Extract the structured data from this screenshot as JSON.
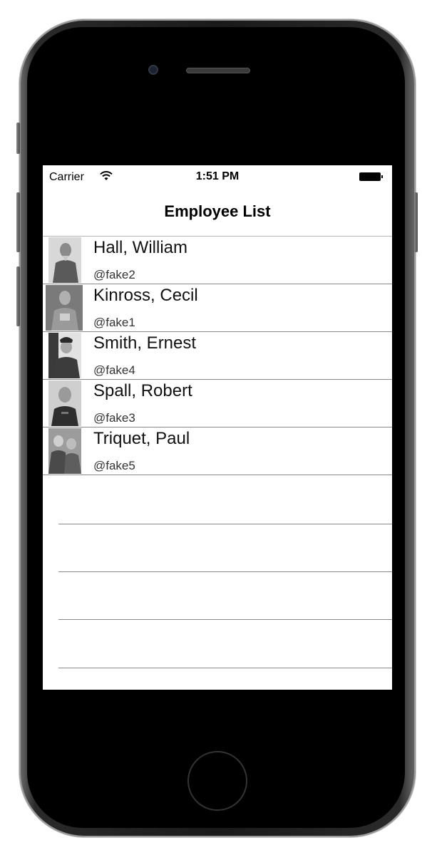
{
  "status_bar": {
    "carrier": "Carrier",
    "time": "1:51 PM"
  },
  "nav": {
    "title": "Employee List"
  },
  "employees": [
    {
      "name": "Hall, William",
      "handle": "@fake2"
    },
    {
      "name": "Kinross, Cecil",
      "handle": "@fake1"
    },
    {
      "name": "Smith, Ernest",
      "handle": "@fake4"
    },
    {
      "name": "Spall, Robert",
      "handle": "@fake3"
    },
    {
      "name": "Triquet, Paul",
      "handle": "@fake5"
    }
  ],
  "icons": {
    "wifi": "wifi-icon",
    "battery": "battery-icon"
  },
  "colors": {
    "screen_bg": "#ffffff",
    "device": "#000000",
    "separator": "#8a8a8a"
  }
}
